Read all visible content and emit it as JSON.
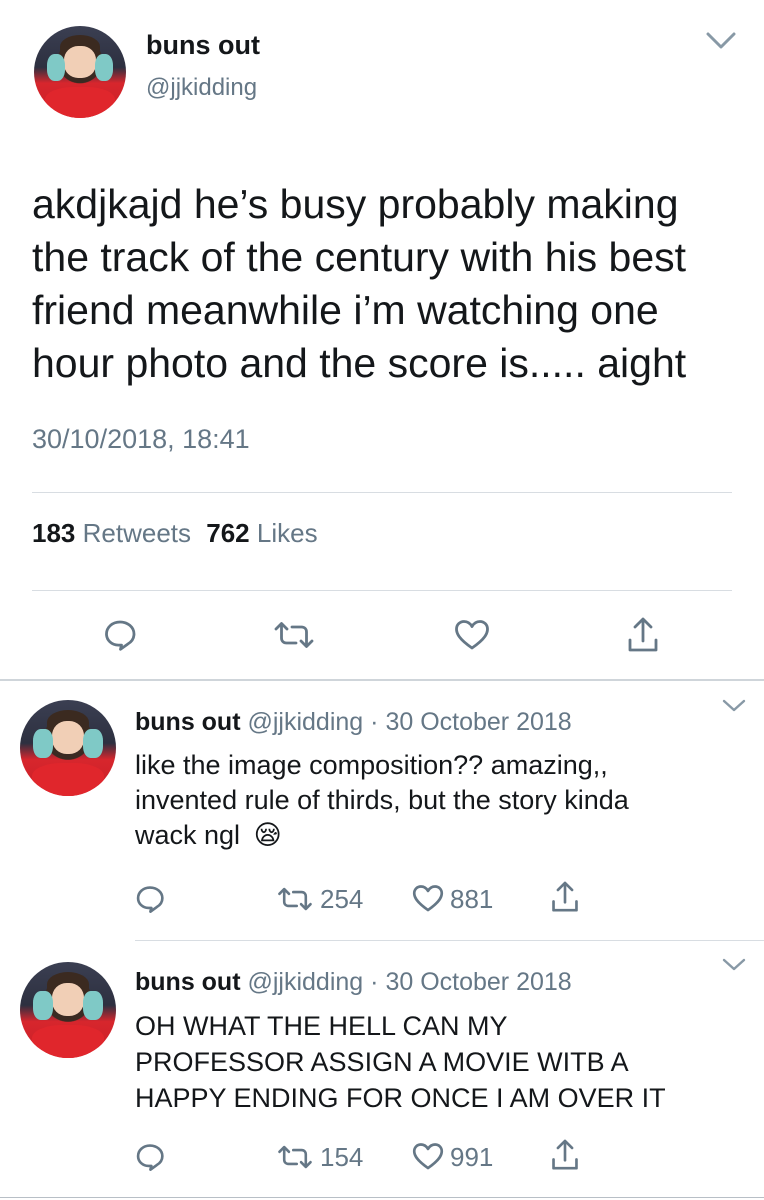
{
  "main_tweet": {
    "display_name": "buns out",
    "handle": "@jjkidding",
    "text_lines": [
      "akdjkajd he’s busy probably making",
      "the track of the century with his best",
      "friend meanwhile i’m watching one",
      "hour photo and the score is..... aight"
    ],
    "timestamp": "30/10/2018, 18:41",
    "retweet_count": "183",
    "retweet_label": "Retweets",
    "like_count": "762",
    "like_label": "Likes"
  },
  "replies": [
    {
      "display_name": "buns out",
      "handle": "@jjkidding",
      "dot": "·",
      "date": "30 October 2018",
      "text_lines": [
        "like the image composition?? amazing,,",
        "invented rule of thirds, but the story kinda",
        "wack ngl"
      ],
      "emoji": "😪",
      "retweets": "254",
      "likes": "881"
    },
    {
      "display_name": "buns out",
      "handle": "@jjkidding",
      "dot": "·",
      "date": "30 October 2018",
      "text_lines": [
        "OH WHAT THE HELL CAN MY",
        "PROFESSOR ASSIGN A MOVIE WITB A",
        "HAPPY ENDING FOR ONCE I AM OVER IT"
      ],
      "retweets": "154",
      "likes": "991"
    }
  ],
  "icons": {
    "reply": "reply-icon",
    "retweet": "retweet-icon",
    "like": "heart-icon",
    "share": "share-icon",
    "more": "chevron-down-icon"
  },
  "colors": {
    "text": "#14171a",
    "secondary": "#657786",
    "divider": "#d8dde2"
  }
}
